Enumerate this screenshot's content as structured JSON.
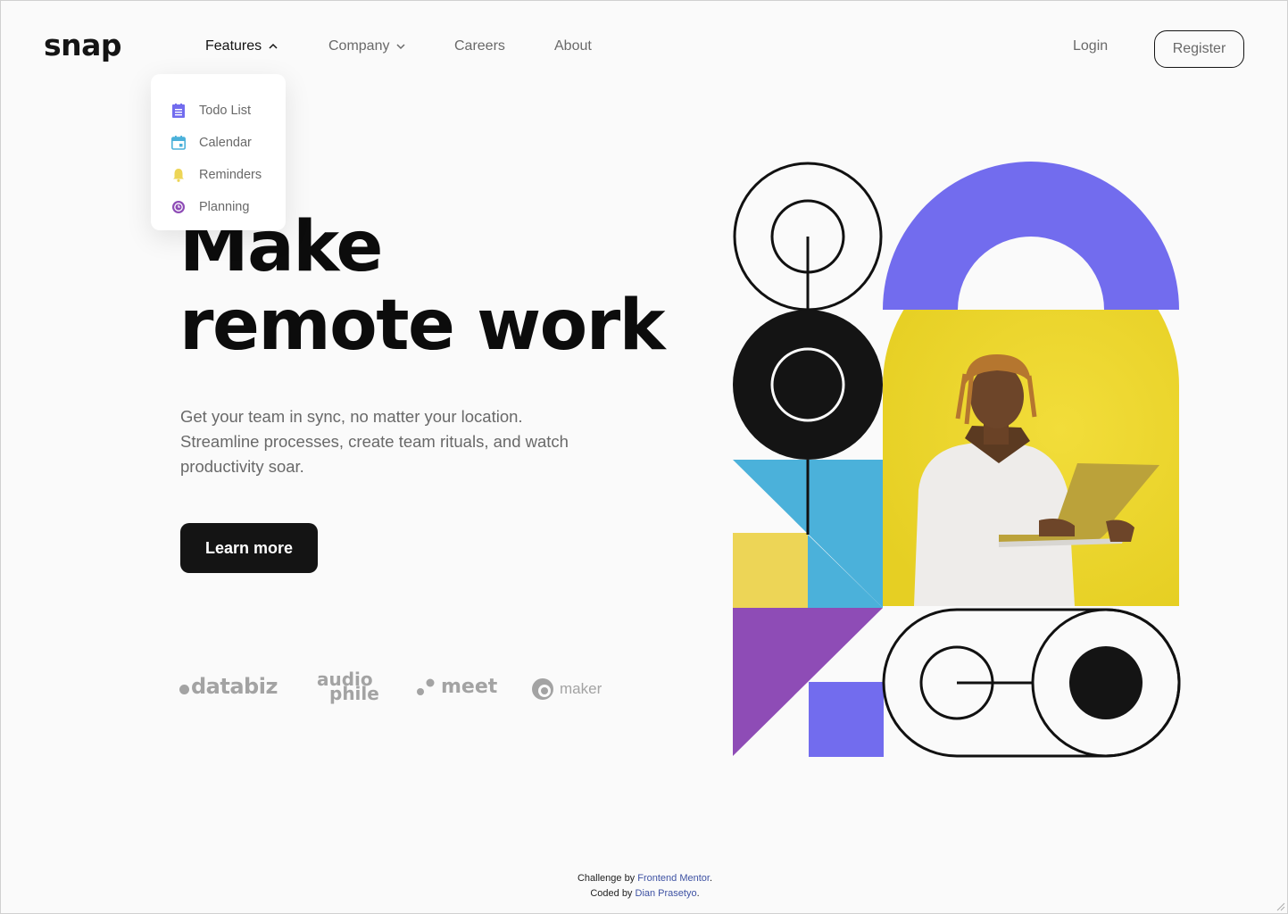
{
  "brand": {
    "logo": "snap"
  },
  "nav": {
    "items": [
      {
        "label": "Features",
        "has_dropdown": true,
        "expanded": true
      },
      {
        "label": "Company",
        "has_dropdown": true,
        "expanded": false
      },
      {
        "label": "Careers"
      },
      {
        "label": "About"
      }
    ],
    "login": "Login",
    "register": "Register"
  },
  "features_dropdown": {
    "items": [
      {
        "label": "Todo List",
        "icon": "todo-list-icon",
        "color": "#726cee"
      },
      {
        "label": "Calendar",
        "icon": "calendar-icon",
        "color": "#4bb1da"
      },
      {
        "label": "Reminders",
        "icon": "bell-icon",
        "color": "#edd556"
      },
      {
        "label": "Planning",
        "icon": "planning-icon",
        "color": "#8e4cb6"
      }
    ]
  },
  "hero": {
    "title_line1": "Make",
    "title_line2": "remote work",
    "text": "Get your team in sync, no matter your location. Streamline processes, create team rituals, and watch productivity soar.",
    "cta": "Learn more"
  },
  "clients": {
    "databiz": "databiz",
    "audiophile_top": "audio",
    "audiophile_bottom": "phile",
    "meet": "meet",
    "maker": "maker"
  },
  "attribution": {
    "line1_prefix": "Challenge by ",
    "line1_link": "Frontend Mentor",
    "line1_suffix": ".",
    "line2_prefix": "Coded by ",
    "line2_link": "Dian Prasetyo",
    "line2_suffix": "."
  },
  "colors": {
    "ink": "#141414",
    "muted": "#696969",
    "purple": "#726cee",
    "blue": "#4bb1da",
    "yellow": "#edd556",
    "violet": "#8e4cb6"
  }
}
